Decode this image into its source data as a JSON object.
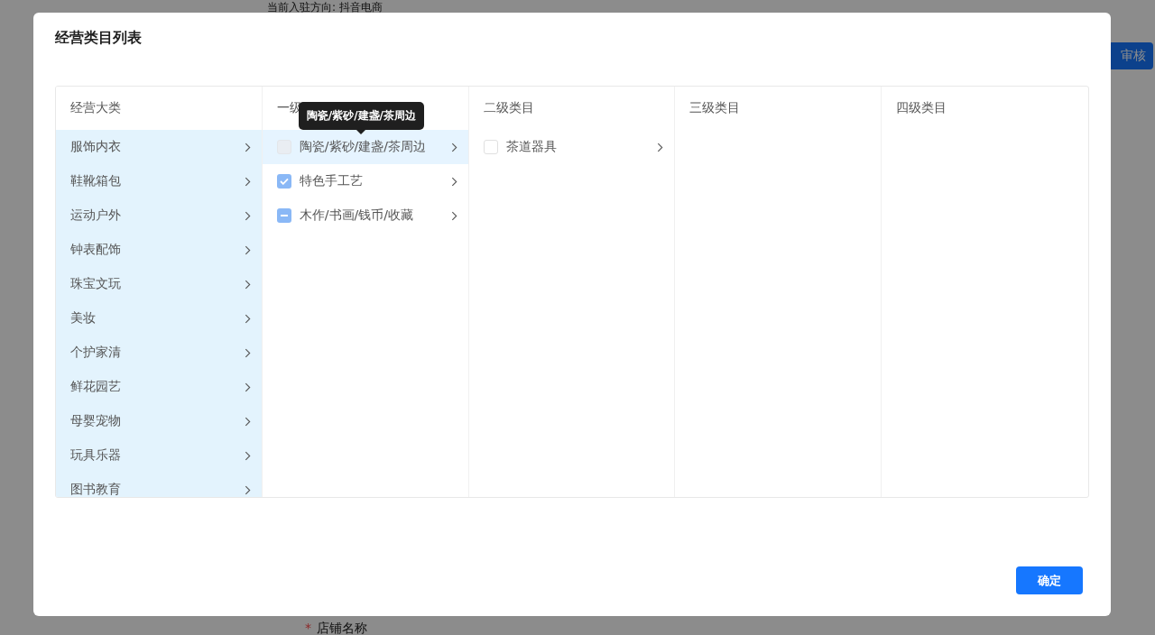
{
  "background": {
    "direction_text": "当前入驻方向: 抖音电商",
    "review_button": "审核",
    "store_name_label": "店铺名称",
    "required_mark": "*"
  },
  "dialog": {
    "title": "经营类目列表",
    "confirm_button": "确定"
  },
  "columns": [
    {
      "header": "经营大类",
      "kind": "plain",
      "items": [
        {
          "label": "服饰内衣"
        },
        {
          "label": "鞋靴箱包"
        },
        {
          "label": "运动户外"
        },
        {
          "label": "钟表配饰"
        },
        {
          "label": "珠宝文玩"
        },
        {
          "label": "美妆"
        },
        {
          "label": "个护家清"
        },
        {
          "label": "鲜花园艺"
        },
        {
          "label": "母婴宠物"
        },
        {
          "label": "玩具乐器"
        },
        {
          "label": "图书教育"
        }
      ]
    },
    {
      "header": "一级",
      "tooltip": "陶瓷/紫砂/建盏/茶周边",
      "kind": "checkbox",
      "items": [
        {
          "label": "陶瓷/紫砂/建盏/茶周边",
          "active": true,
          "checked": false,
          "indeterminate": false,
          "disabled": true
        },
        {
          "label": "特色手工艺",
          "active": false,
          "checked": true,
          "indeterminate": false,
          "disabled": false
        },
        {
          "label": "木作/书画/钱币/收藏",
          "active": false,
          "checked": false,
          "indeterminate": true,
          "disabled": false
        }
      ]
    },
    {
      "header": "二级类目",
      "kind": "checkbox",
      "items": [
        {
          "label": "茶道器具",
          "active": false,
          "checked": false,
          "indeterminate": false,
          "disabled": false
        }
      ]
    },
    {
      "header": "三级类目"
    },
    {
      "header": "四级类目"
    }
  ]
}
